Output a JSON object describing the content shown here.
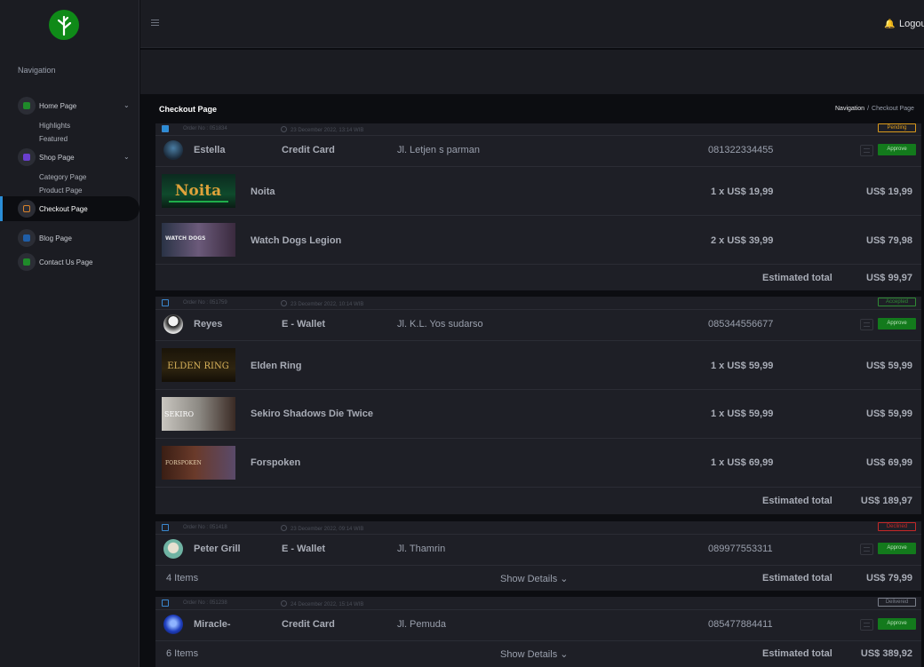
{
  "app": {
    "logout_label": "Logout"
  },
  "sidebar": {
    "heading": "Navigation",
    "items": [
      {
        "label": "Home Page",
        "sub": [
          "Highlights",
          "Featured"
        ]
      },
      {
        "label": "Shop Page",
        "sub": [
          "Category Page",
          "Product Page"
        ]
      },
      {
        "label": "Checkout Page"
      },
      {
        "label": "Blog Page"
      },
      {
        "label": "Contact Us Page"
      }
    ]
  },
  "page": {
    "title": "Checkout Page",
    "breadcrumb": [
      "Navigation",
      "Checkout Page"
    ]
  },
  "labels": {
    "order_no": "Order No :",
    "approve": "Approve",
    "estimated_total": "Estimated total",
    "show_details": "Show Details"
  },
  "orders": [
    {
      "order_no": "051834",
      "date": "23 December 2022, 13:14 WIB",
      "status": "Pending",
      "customer": "Estella",
      "payment": "Credit Card",
      "address": "Jl. Letjen s parman",
      "phone": "081322334455",
      "items": [
        {
          "name": "Noita",
          "qty": "1",
          "price": "US$ 19,99",
          "total": "US$ 19,99"
        },
        {
          "name": "Watch Dogs Legion",
          "qty": "2",
          "price": "US$ 39,99",
          "total": "US$ 79,98"
        }
      ],
      "estimated_total": "US$ 99,97"
    },
    {
      "order_no": "051759",
      "date": "23 December 2022, 10:14 WIB",
      "status": "Accepted",
      "customer": "Reyes",
      "payment": "E - Wallet",
      "address": "Jl. K.L. Yos sudarso",
      "phone": "085344556677",
      "items": [
        {
          "name": "Elden Ring",
          "qty": "1",
          "price": "US$ 59,99",
          "total": "US$ 59,99"
        },
        {
          "name": "Sekiro Shadows Die Twice",
          "qty": "1",
          "price": "US$ 59,99",
          "total": "US$ 59,99"
        },
        {
          "name": "Forspoken",
          "qty": "1",
          "price": "US$ 69,99",
          "total": "US$ 69,99"
        }
      ],
      "estimated_total": "US$ 189,97"
    },
    {
      "order_no": "051418",
      "date": "23 December 2022, 09:14 WIB",
      "status": "Declined",
      "customer": "Peter Grill",
      "payment": "E - Wallet",
      "address": "Jl. Thamrin",
      "phone": "089977553311",
      "items_count": "4 Items",
      "estimated_total": "US$ 79,99"
    },
    {
      "order_no": "051238",
      "date": "24 December 2022, 15:14 WIB",
      "status": "Delivered",
      "customer": "Miracle-",
      "payment": "Credit Card",
      "address": "Jl. Pemuda",
      "phone": "085477884411",
      "items_count": "6 Items",
      "estimated_total": "US$ 389,92"
    }
  ],
  "colors": {
    "accent": "#2a8dd6",
    "approve": "#137a1c",
    "pending": "#d99a1c",
    "accepted": "#2f8a34",
    "declined": "#c62828",
    "delivered": "#7a7f8a"
  }
}
